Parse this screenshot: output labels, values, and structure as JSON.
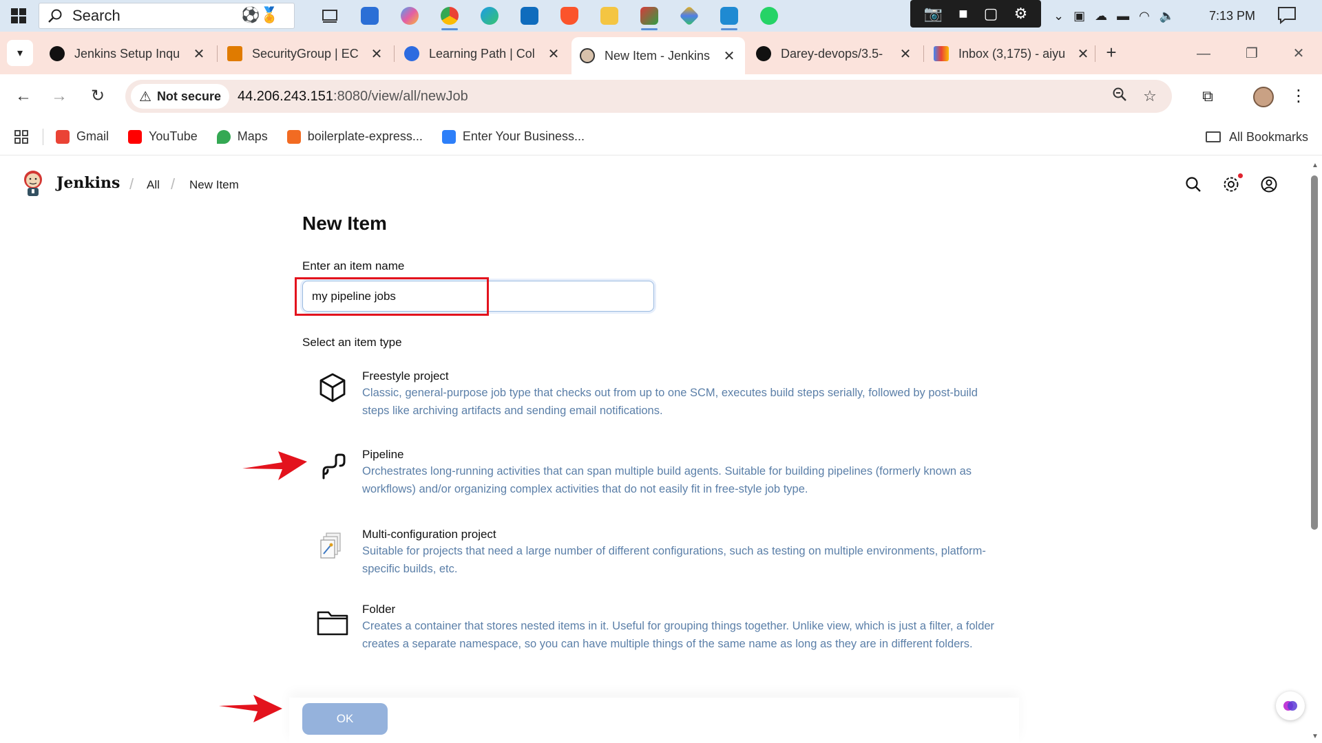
{
  "taskbar": {
    "search_placeholder": "Search",
    "clock": "7:13 PM",
    "pinned_apps": [
      "file-explorer-tiles",
      "microsoft-store",
      "copilot",
      "chrome",
      "edge",
      "outlook",
      "brave",
      "file-explorer",
      "screen-tool",
      "dev-tool",
      "vscode",
      "whatsapp"
    ]
  },
  "tabs": [
    {
      "title": "Jenkins Setup Inqu",
      "icon": "openai-icon"
    },
    {
      "title": "SecurityGroup | EC",
      "icon": "aws-icon"
    },
    {
      "title": "Learning Path | Col",
      "icon": "learning-icon"
    },
    {
      "title": "New Item - Jenkins",
      "icon": "jenkins-icon",
      "active": true
    },
    {
      "title": "Darey-devops/3.5-",
      "icon": "github-icon"
    },
    {
      "title": "Inbox (3,175) - aiyu",
      "icon": "gmail-icon"
    }
  ],
  "address_bar": {
    "security_label": "Not secure",
    "url_host": "44.206.243.151",
    "url_rest": ":8080/view/all/newJob"
  },
  "bookmarks": [
    {
      "label": "Gmail",
      "color": "#ea4335"
    },
    {
      "label": "YouTube",
      "color": "#ff0000"
    },
    {
      "label": "Maps",
      "color": "#34a853"
    },
    {
      "label": "boilerplate-express...",
      "color": "#f26b22"
    },
    {
      "label": "Enter Your Business...",
      "color": "#2d7ff9"
    }
  ],
  "all_bookmarks_label": "All Bookmarks",
  "jenkins": {
    "brand": "Jenkins",
    "breadcrumbs": [
      "All",
      "New Item"
    ],
    "page_title": "New Item",
    "item_name_label": "Enter an item name",
    "item_name_value": "my pipeline jobs",
    "item_type_label": "Select an item type",
    "item_types": [
      {
        "name": "Freestyle project",
        "description": "Classic, general-purpose job type that checks out from up to one SCM, executes build steps serially, followed by post-build steps like archiving artifacts and sending email notifications."
      },
      {
        "name": "Pipeline",
        "description": "Orchestrates long-running activities that can span multiple build agents. Suitable for building pipelines (formerly known as workflows) and/or organizing complex activities that do not easily fit in free-style job type."
      },
      {
        "name": "Multi-configuration project",
        "description": "Suitable for projects that need a large number of different configurations, such as testing on multiple environments, platform-specific builds, etc."
      },
      {
        "name": "Folder",
        "description": "Creates a container that stores nested items in it. Useful for grouping things together. Unlike view, which is just a filter, a folder creates a separate namespace, so you can have multiple things of the same name as long as they are in different folders."
      }
    ],
    "ok_label": "OK"
  },
  "colors": {
    "tabstrip_bg": "#fbe3dc",
    "description_text": "#5b7fa8",
    "ok_button": "#95b2dc",
    "annotation_red": "#e3131d"
  }
}
